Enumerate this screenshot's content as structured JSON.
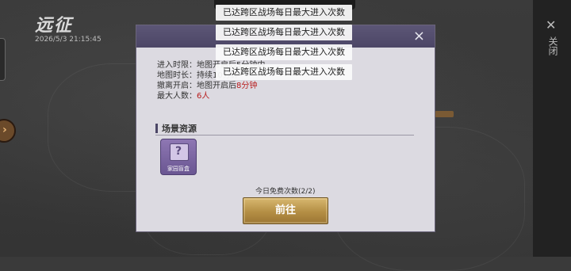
{
  "top": {
    "title": "远征",
    "timestamp": "2026/5/3 21:15:45"
  },
  "right_panel": {
    "close_label": "关闭"
  },
  "dialog": {
    "close_glyph": "×",
    "info_rows": [
      {
        "label": "进入时限：",
        "value": "地图开启后5分钟内",
        "value_red": ""
      },
      {
        "label": "地图时长：",
        "value": "持续10分钟",
        "value_red": ""
      },
      {
        "label": "撤离开启：",
        "value": "地图开启后",
        "value_red": "8分钟"
      },
      {
        "label": "最大人数：",
        "value": "",
        "value_red": "6人"
      }
    ],
    "section_title": "场景资源",
    "resource_item": {
      "name": "家园盲盒",
      "glyph": "?"
    },
    "free_count_text": "今日免费次数(2/2)",
    "go_button": "前往"
  },
  "toasts": [
    "已达跨区战场每日最大进入次数",
    "已达跨区战场每日最大进入次数",
    "已达跨区战场每日最大进入次数",
    "已达跨区战场每日最大进入次数"
  ]
}
